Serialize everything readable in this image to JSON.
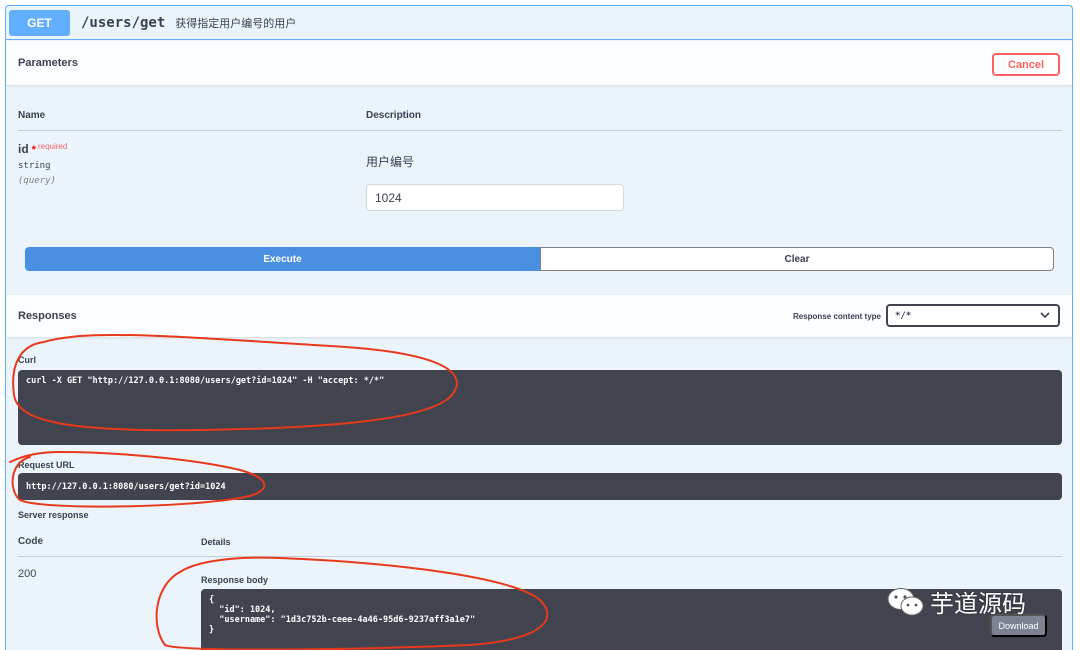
{
  "summary": {
    "method": "GET",
    "path": "/users/get",
    "description": "获得指定用户编号的用户"
  },
  "parameters": {
    "title": "Parameters",
    "cancel_label": "Cancel",
    "col_name": "Name",
    "col_description": "Description",
    "param": {
      "name": "id",
      "star": "*",
      "required": "required",
      "type": "string",
      "in": "(query)",
      "description": "用户编号",
      "value": "1024"
    },
    "execute_label": "Execute",
    "clear_label": "Clear"
  },
  "responses": {
    "title": "Responses",
    "content_type_label": "Response content type",
    "content_type_value": "*/*",
    "curl_label": "Curl",
    "curl": "curl -X GET \"http://127.0.0.1:8080/users/get?id=1024\" -H \"accept: */*\"",
    "request_url_label": "Request URL",
    "request_url": "http://127.0.0.1:8080/users/get?id=1024",
    "server_response_label": "Server response",
    "col_code": "Code",
    "col_details": "Details",
    "code": "200",
    "body_label": "Response body",
    "body": "{\n  \"id\": 1024,\n  \"username\": \"1d3c752b-ceee-4a46-95d6-9237aff3a1e7\"\n}",
    "download_label": "Download"
  },
  "watermark": {
    "text": "芋道源码",
    "icon": "wechat-icon"
  },
  "colors": {
    "get_blue": "#61affe",
    "execute_blue": "#4990e2",
    "cancel_red": "#ff6060",
    "code_bg": "#41444e",
    "annotation_red": "#e8391c"
  }
}
